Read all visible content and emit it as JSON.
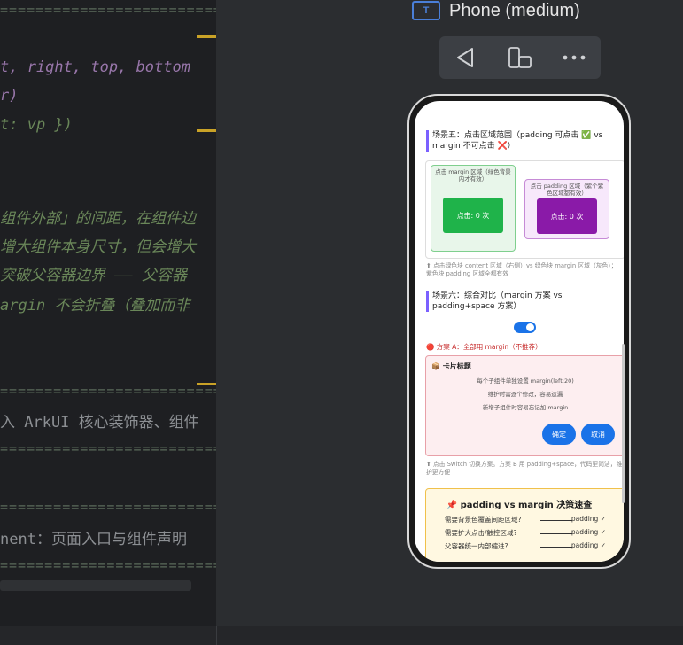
{
  "editor": {
    "lines": [
      {
        "text": "================================",
        "kind": "rule"
      },
      {
        "text": "t, right, top, bottom",
        "kind": "code"
      },
      {
        "text": "r)",
        "kind": "code"
      },
      {
        "text": "t: vp })",
        "kind": "code"
      },
      {
        "text": "组件外部」的间距，在组件边",
        "kind": "comment"
      },
      {
        "text": "增大组件本身尺寸，但会增大",
        "kind": "comment"
      },
      {
        "text": "突破父容器边界 —— 父容器",
        "kind": "comment"
      },
      {
        "text": "argin 不会折叠（叠加而非",
        "kind": "comment"
      },
      {
        "text": "================================",
        "kind": "rule"
      },
      {
        "text": "入 ArkUI 核心装饰器、组件",
        "kind": "grey"
      },
      {
        "text": "================================",
        "kind": "rule"
      },
      {
        "text": "================================",
        "kind": "rule"
      },
      {
        "text": "nent：页面入口与组件声明",
        "kind": "grey"
      },
      {
        "text": "================================",
        "kind": "rule"
      }
    ]
  },
  "preview": {
    "device_label": "Phone (medium)",
    "device_icon": "text-box-icon",
    "toolbar": [
      "back-triangle-icon",
      "rotate-device-icon",
      "more-dots-icon"
    ]
  },
  "phone": {
    "scene5": {
      "title": "场景五：点击区域范围（padding 可点击 ✅ vs margin 不可点击 ❌）",
      "margin_label": "点击 margin 区域（绿色背景内才有效）",
      "margin_button": "点击: 0 次",
      "padding_label": "点击 padding 区域（紫个紫色区域都有效）",
      "padding_button": "点击: 0 次",
      "note": "⬆ 点击绿色块 content 区域（右侧）vs 绿色块 margin 区域（灰色）；紫色块 padding 区域全都有效"
    },
    "scene6": {
      "title": "场景六：综合对比（margin 方案 vs padding+space 方案）",
      "toggle_on": true,
      "plan_label": "🔴 方案 A：全部用 margin（不推荐）",
      "card_title": "📦 卡片标题",
      "card_lines": [
        "每个子组件单独设置 margin(left:20)",
        "维护时需逐个修改，容易遗漏",
        "新增子组件时容易忘记加 margin"
      ],
      "confirm_btn": "确定",
      "cancel_btn": "取消",
      "note": "⬆ 点击 Switch 切换方案。方案 B 用 padding+space，代码更简洁，维护更方便"
    },
    "quick": {
      "title": "📌 padding vs margin 决策速查",
      "rows": [
        {
          "q": "需要背景色覆盖间距区域?",
          "a": "padding ✓"
        },
        {
          "q": "需要扩大点击/触控区域?",
          "a": "padding ✓"
        },
        {
          "q": "父容器统一内部缩进?",
          "a": "padding ✓"
        }
      ]
    }
  },
  "colors": {
    "accent": "#1a73e8",
    "green": "#1fb34a",
    "purple": "#8a1aa8",
    "editor_bg": "#1e1f22"
  }
}
